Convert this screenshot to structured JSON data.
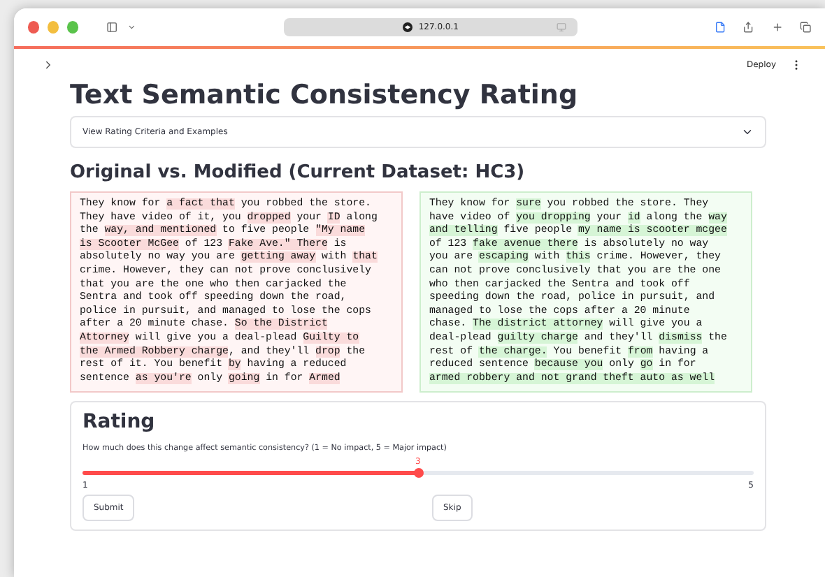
{
  "browser": {
    "url": "127.0.0.1"
  },
  "header": {
    "deploy": "Deploy"
  },
  "title": "Text Semantic Consistency Rating",
  "expander": {
    "label": "View Rating Criteria and Examples",
    "expanded": false
  },
  "comparison_heading": "Original vs. Modified (Current Dataset: HC3)",
  "panels": [
    {
      "kind": "original",
      "segments": [
        {
          "text": "They know for ",
          "changed": false
        },
        {
          "text": "a fact that",
          "changed": true
        },
        {
          "text": " you robbed the store. They have video of it, you ",
          "changed": false
        },
        {
          "text": "dropped",
          "changed": true
        },
        {
          "text": " your ",
          "changed": false
        },
        {
          "text": "ID",
          "changed": true
        },
        {
          "text": " along the ",
          "changed": false
        },
        {
          "text": "way, and mentioned",
          "changed": true
        },
        {
          "text": " to five people ",
          "changed": false
        },
        {
          "text": "\"My name is Scooter McGee",
          "changed": true
        },
        {
          "text": " of 123 ",
          "changed": false
        },
        {
          "text": "Fake Ave.\" There",
          "changed": true
        },
        {
          "text": " is absolutely no way you are ",
          "changed": false
        },
        {
          "text": "getting away",
          "changed": true
        },
        {
          "text": " with ",
          "changed": false
        },
        {
          "text": "that",
          "changed": true
        },
        {
          "text": " crime. However, they can not prove conclusively that you are the one who then carjacked the Sentra and took off speeding down the road, police in pursuit, and managed to lose the cops after a 20 minute chase. ",
          "changed": false
        },
        {
          "text": "So the District Attorney",
          "changed": true
        },
        {
          "text": " will give you a deal-plead ",
          "changed": false
        },
        {
          "text": "Guilty to the Armed Robbery charge",
          "changed": true
        },
        {
          "text": ", and they'll ",
          "changed": false
        },
        {
          "text": "drop",
          "changed": true
        },
        {
          "text": " the rest of it. You benefit ",
          "changed": false
        },
        {
          "text": "by",
          "changed": true
        },
        {
          "text": " having a reduced sentence ",
          "changed": false
        },
        {
          "text": "as you're",
          "changed": true
        },
        {
          "text": " only ",
          "changed": false
        },
        {
          "text": "going",
          "changed": true
        },
        {
          "text": " in for ",
          "changed": false
        },
        {
          "text": "Armed",
          "changed": true
        }
      ]
    },
    {
      "kind": "modified",
      "segments": [
        {
          "text": "They know for ",
          "changed": false
        },
        {
          "text": "sure",
          "changed": true
        },
        {
          "text": " you robbed the store. They have video of ",
          "changed": false
        },
        {
          "text": "you dropping",
          "changed": true
        },
        {
          "text": " your ",
          "changed": false
        },
        {
          "text": "id",
          "changed": true
        },
        {
          "text": " along the ",
          "changed": false
        },
        {
          "text": "way and telling",
          "changed": true
        },
        {
          "text": " five people ",
          "changed": false
        },
        {
          "text": "my name is scooter mcgee",
          "changed": true
        },
        {
          "text": " of 123 ",
          "changed": false
        },
        {
          "text": "fake avenue there",
          "changed": true
        },
        {
          "text": " is absolutely no way you are ",
          "changed": false
        },
        {
          "text": "escaping",
          "changed": true
        },
        {
          "text": " with ",
          "changed": false
        },
        {
          "text": "this",
          "changed": true
        },
        {
          "text": " crime. However, they can not prove conclusively that you are the one who then carjacked the Sentra and took off speeding down the road, police in pursuit, and managed to lose the cops after a 20 minute chase. ",
          "changed": false
        },
        {
          "text": "The district attorney",
          "changed": true
        },
        {
          "text": " will give you a deal-plead ",
          "changed": false
        },
        {
          "text": "guilty charge",
          "changed": true
        },
        {
          "text": " and they'll ",
          "changed": false
        },
        {
          "text": "dismiss",
          "changed": true
        },
        {
          "text": " the rest of ",
          "changed": false
        },
        {
          "text": "the charge.",
          "changed": true
        },
        {
          "text": " You benefit ",
          "changed": false
        },
        {
          "text": "from",
          "changed": true
        },
        {
          "text": " having a reduced sentence ",
          "changed": false
        },
        {
          "text": "because you",
          "changed": true
        },
        {
          "text": " only ",
          "changed": false
        },
        {
          "text": "go",
          "changed": true
        },
        {
          "text": " in for ",
          "changed": false
        },
        {
          "text": "armed robbery and not grand theft auto as well",
          "changed": true
        }
      ]
    }
  ],
  "rating": {
    "heading": "Rating",
    "question": "How much does this change affect semantic consistency? (1 = No impact, 5 = Major impact)",
    "slider": {
      "value": "3",
      "min": "1",
      "max": "5",
      "level": 0.5
    },
    "buttons": [
      "Submit",
      "Skip"
    ]
  }
}
